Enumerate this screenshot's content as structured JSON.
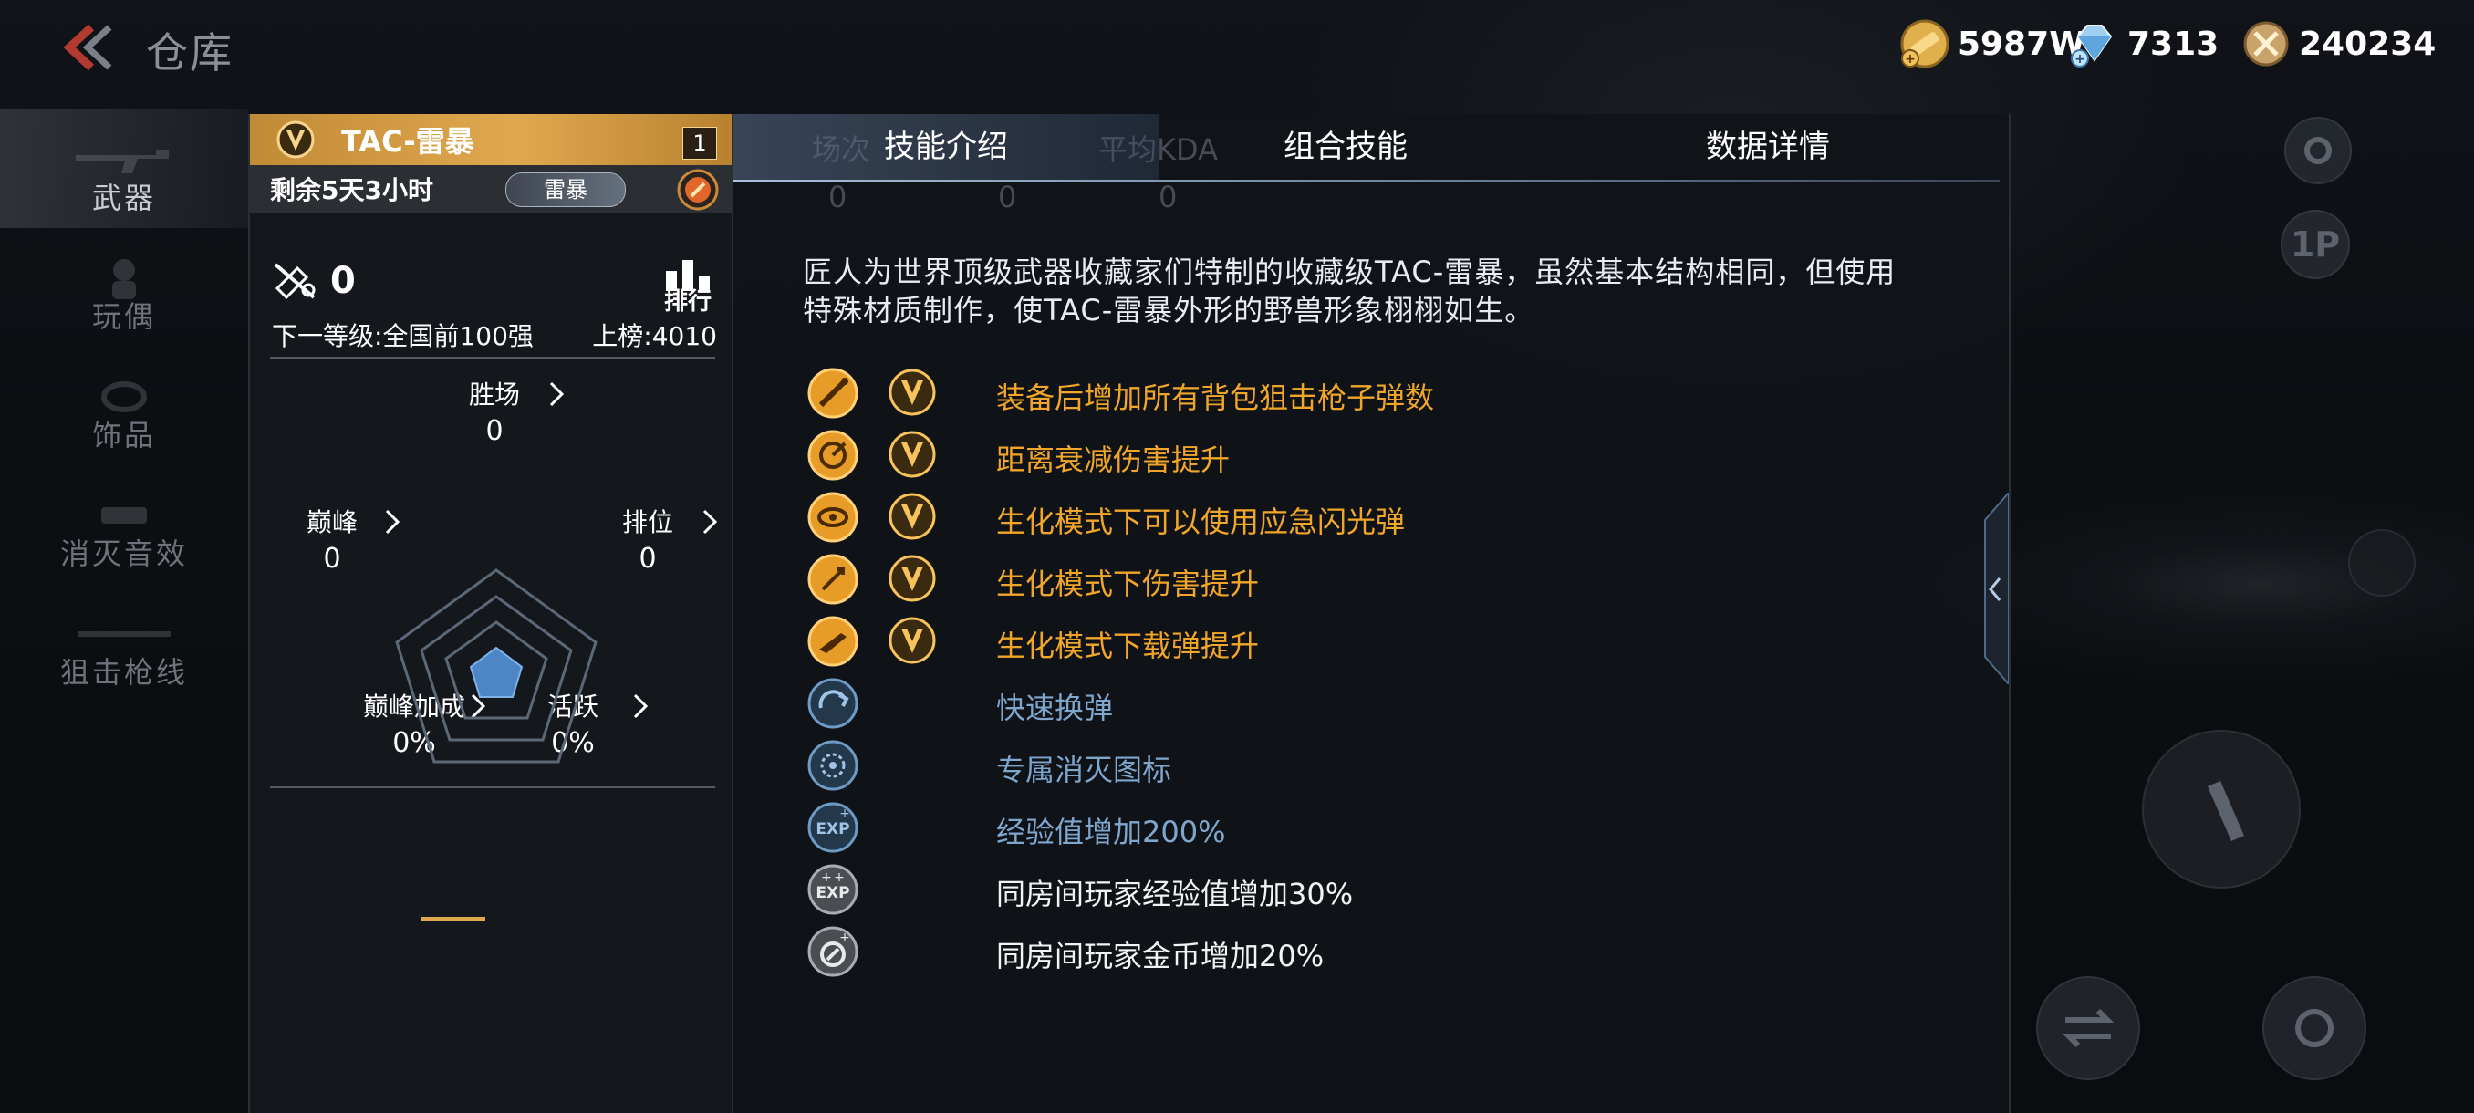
{
  "header": {
    "title": "仓库",
    "currencies": [
      {
        "icon": "gold-coin-icon",
        "value": "5987W"
      },
      {
        "icon": "diamond-icon",
        "value": "7313"
      },
      {
        "icon": "token-coin-icon",
        "value": "240234"
      }
    ]
  },
  "nav": {
    "items": [
      {
        "label": "武器",
        "active": true
      },
      {
        "label": "玩偶",
        "active": false
      },
      {
        "label": "饰品",
        "active": false
      },
      {
        "label": "消灭音效",
        "active": false
      },
      {
        "label": "狙击枪线",
        "active": false
      }
    ]
  },
  "weapon": {
    "name": "TAC-雷暴",
    "level": "1",
    "remaining": "剩余5天3小时",
    "tag": "雷暴",
    "kills": "0",
    "rank_label": "排行",
    "next_level": "下一等级:全国前100强",
    "on_board": "上榜:4010",
    "stats": {
      "wins": {
        "label": "胜场",
        "value": "0"
      },
      "peak": {
        "label": "巅峰",
        "value": "0"
      },
      "ranked": {
        "label": "排位",
        "value": "0"
      },
      "peak_bonus": {
        "label": "巅峰加成",
        "value": "0%"
      },
      "active": {
        "label": "活跃",
        "value": "0%"
      }
    }
  },
  "tabs": [
    {
      "label": "技能介绍",
      "active": true
    },
    {
      "label": "组合技能",
      "active": false
    },
    {
      "label": "数据详情",
      "active": false
    }
  ],
  "ghost_columns": {
    "c1": "场次",
    "c2": "平均KDA",
    "v1": "0",
    "v2": "0",
    "v3": "0"
  },
  "description": "匠人为世界顶级武器收藏家们特制的收藏级TAC-雷暴，虽然基本结构相同，但使用特殊材质制作，使TAC-雷暴外形的野兽形象栩栩如生。",
  "skills": [
    {
      "text": "装备后增加所有背包狙击枪子弹数",
      "style": "gold",
      "icon": "bullet-skill-icon",
      "v_badge": true
    },
    {
      "text": "距离衰减伤害提升",
      "style": "gold",
      "icon": "range-skill-icon",
      "v_badge": true
    },
    {
      "text": "生化模式下可以使用应急闪光弹",
      "style": "gold",
      "icon": "flash-skill-icon",
      "v_badge": true
    },
    {
      "text": "生化模式下伤害提升",
      "style": "gold",
      "icon": "damage-skill-icon",
      "v_badge": true
    },
    {
      "text": "生化模式下载弹提升",
      "style": "gold",
      "icon": "ammo-skill-icon",
      "v_badge": true
    },
    {
      "text": "快速换弹",
      "style": "blue",
      "icon": "reload-icon",
      "v_badge": false
    },
    {
      "text": "专属消灭图标",
      "style": "blue",
      "icon": "kill-mark-icon",
      "v_badge": false
    },
    {
      "text": "经验值增加200%",
      "style": "blue",
      "icon": "exp-icon",
      "v_badge": false
    },
    {
      "text": "同房间玩家经验值增加30%",
      "style": "white",
      "icon": "room-exp-icon",
      "v_badge": false
    },
    {
      "text": "同房间玩家金币增加20%",
      "style": "white",
      "icon": "room-gold-icon",
      "v_badge": false
    }
  ],
  "right_controls": {
    "view_label": "1P"
  },
  "colors": {
    "gold": "#f1a629",
    "blue": "#7fa6cc",
    "header_gold": "#e0a84e"
  }
}
